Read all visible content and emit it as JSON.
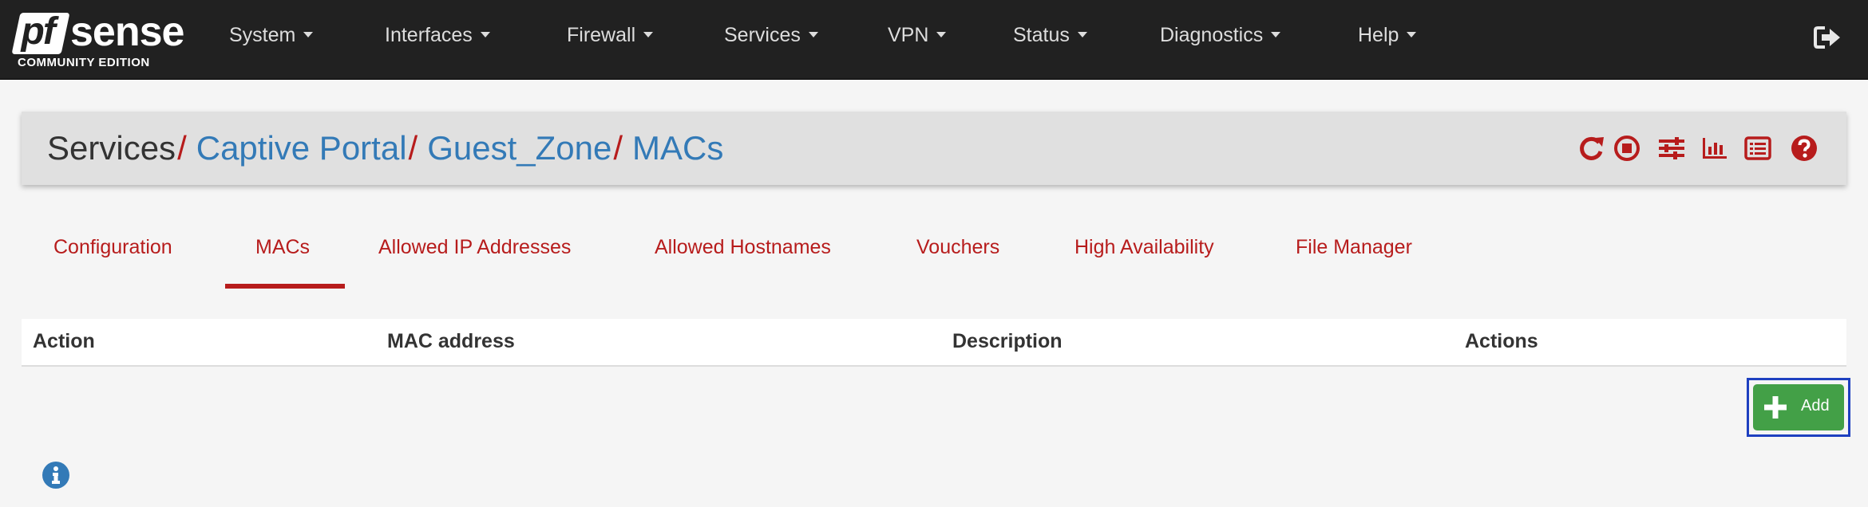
{
  "brand": {
    "logo_mark": "pf",
    "logo_word": "sense",
    "edition": "COMMUNITY EDITION"
  },
  "nav": {
    "items": [
      {
        "label": "System"
      },
      {
        "label": "Interfaces"
      },
      {
        "label": "Firewall"
      },
      {
        "label": "Services"
      },
      {
        "label": "VPN"
      },
      {
        "label": "Status"
      },
      {
        "label": "Diagnostics"
      },
      {
        "label": "Help"
      }
    ],
    "logout_icon": "sign-out-icon"
  },
  "breadcrumb": {
    "root": "Services",
    "separator": "/",
    "links": [
      "Captive Portal",
      "Guest_Zone",
      "MACs"
    ]
  },
  "header_icons": [
    "restart-icon",
    "stop-icon",
    "settings-sliders-icon",
    "bar-chart-icon",
    "list-icon",
    "help-icon"
  ],
  "tabs": [
    {
      "label": "Configuration",
      "active": false
    },
    {
      "label": "MACs",
      "active": true
    },
    {
      "label": "Allowed IP Addresses",
      "active": false
    },
    {
      "label": "Allowed Hostnames",
      "active": false
    },
    {
      "label": "Vouchers",
      "active": false
    },
    {
      "label": "High Availability",
      "active": false
    },
    {
      "label": "File Manager",
      "active": false
    }
  ],
  "table": {
    "headers": [
      "Action",
      "MAC address",
      "Description",
      "Actions"
    ],
    "rows": []
  },
  "add_button": {
    "label": "Add",
    "icon": "plus-icon"
  },
  "info_icon": "info-icon",
  "colors": {
    "navbar": "#212121",
    "accent_red": "#b71c1c",
    "link_blue": "#337ab7",
    "success_green": "#43a047"
  }
}
